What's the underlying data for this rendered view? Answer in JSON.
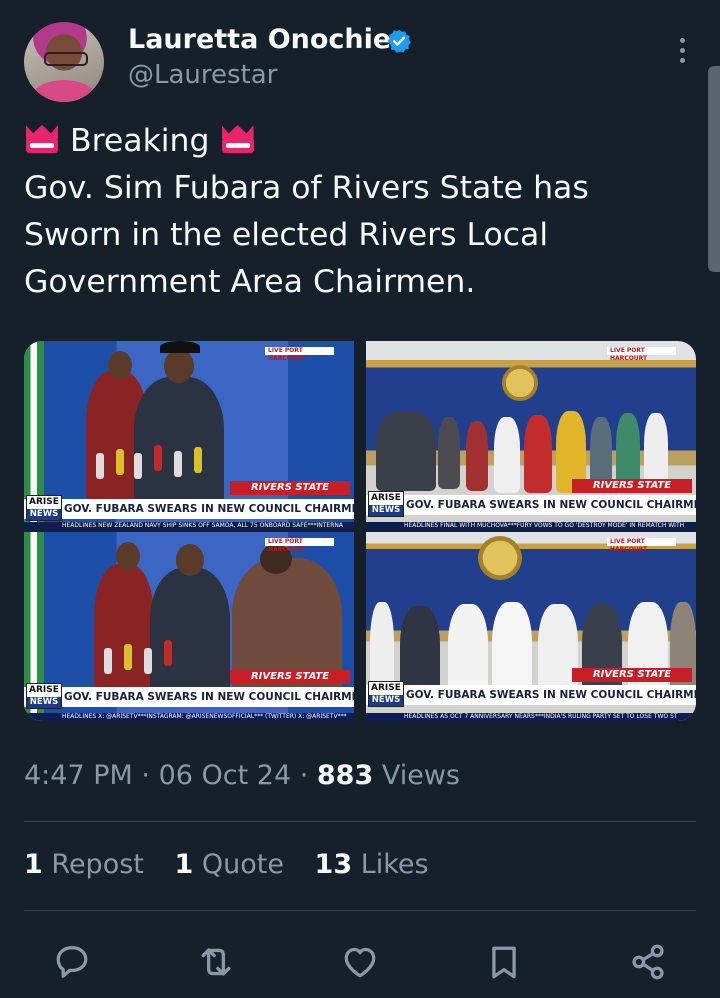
{
  "author": {
    "display_name": "Lauretta Onochie",
    "handle": "@Laurestar",
    "verified_icon": "verified-badge-icon",
    "verified_color": "#1d9bf0"
  },
  "tweet": {
    "line1": "Breaking",
    "line2": "Gov. Sim Fubara of Rivers State has",
    "line3": "Sworn in the elected Rivers Local",
    "line4": "Government Area Chairmen.",
    "emoji": "crown-badge-icon"
  },
  "media": {
    "tiles": [
      {
        "headline": "GOV. FUBARA SWEARS IN NEW COUNCIL CHAIRMEN",
        "tag": "RIVERS STATE",
        "live": "LIVE  PORT HARCOURT",
        "ticker": "HEADLINES NEW ZEALAND NAVY SHIP SINKS OFF SAMOA, ALL 75 ONBOARD SAFE***INTERNA"
      },
      {
        "headline": "GOV. FUBARA SWEARS IN NEW COUNCIL CHAIRMEN",
        "tag": "RIVERS STATE",
        "live": "LIVE  PORT HARCOURT",
        "ticker": "HEADLINES FINAL WITH MUCHOVA***FURY VOWS TO GO 'DESTROY MODE' IN REMATCH WITH"
      },
      {
        "headline": "GOV. FUBARA SWEARS IN NEW COUNCIL CHAIRMEN",
        "tag": "RIVERS STATE",
        "live": "LIVE  PORT HARCOURT",
        "ticker": "HEADLINES X: @ARISETV***INSTAGRAM: @ARISENEWSOFFICIAL*** (TWITTER) X: @ARISETV***"
      },
      {
        "headline": "GOV. FUBARA SWEARS IN NEW COUNCIL CHAIRMEN",
        "tag": "RIVERS STATE",
        "live": "LIVE  PORT HARCOURT",
        "ticker": "HEADLINES AS OCT 7 ANNIVERSARY NEARS***INDIA'S RULING PARTY SET TO LOSE TWO ST"
      }
    ],
    "logo_top": "ARISE",
    "logo_bottom": "NEWS"
  },
  "meta": {
    "time": "4:47 PM",
    "date": "06 Oct 24",
    "views_count": "883",
    "views_label": "Views"
  },
  "stats": {
    "reposts_count": "1",
    "reposts_label": "Repost",
    "quotes_count": "1",
    "quotes_label": "Quote",
    "likes_count": "13",
    "likes_label": "Likes"
  },
  "colors": {
    "background": "#15202b",
    "text_primary": "#f7f9f9",
    "text_secondary": "#8b98a5",
    "divider": "#38444d"
  }
}
